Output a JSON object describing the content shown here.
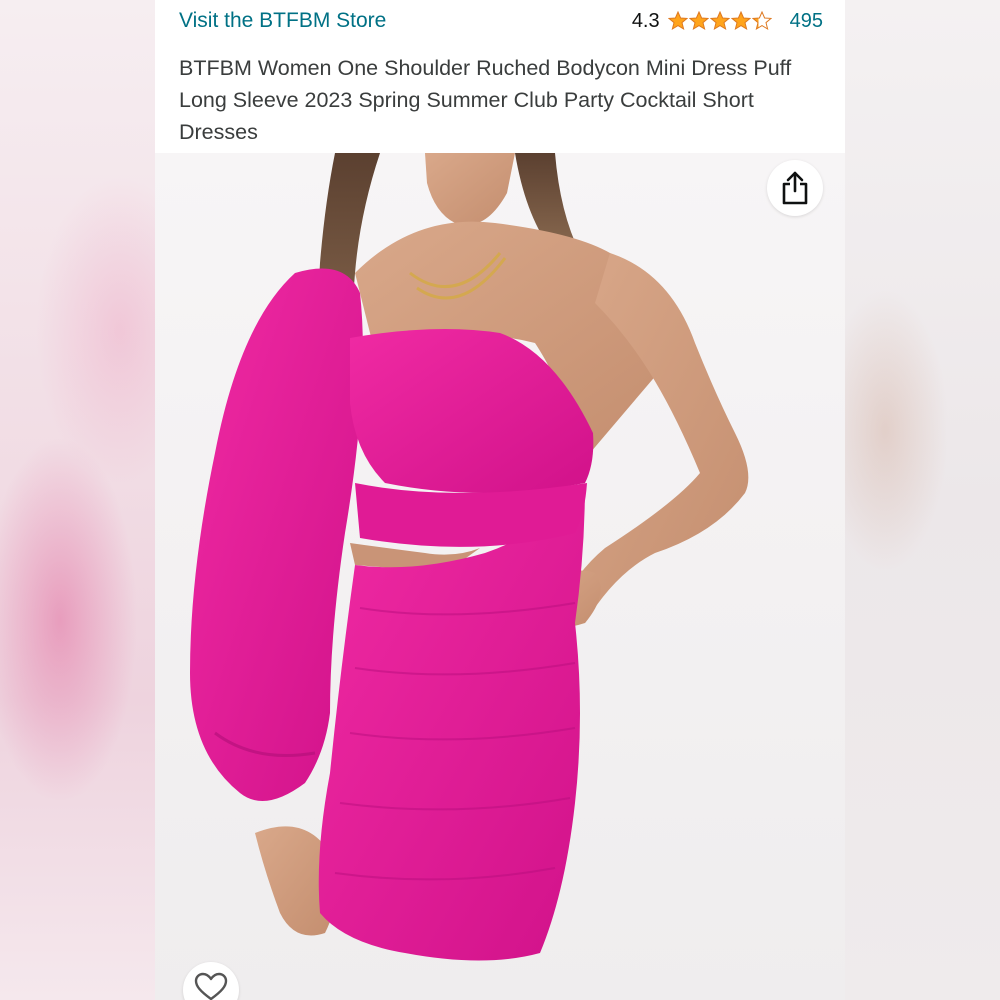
{
  "header": {
    "store_link": "Visit the BTFBM Store",
    "rating_value": "4.3",
    "rating_stars": 4.3,
    "rating_count": "495"
  },
  "product": {
    "title": "BTFBM Women One Shoulder Ruched Bodycon Mini Dress Puff Long Sleeve 2023 Spring Summer Club Party Cocktail Short Dresses"
  },
  "icons": {
    "share": "share-icon",
    "wishlist": "heart-icon",
    "star": "star-icon"
  },
  "colors": {
    "link": "#007185",
    "star": "#ffa41c",
    "text": "#0f1111",
    "dress": "#e8179a"
  }
}
